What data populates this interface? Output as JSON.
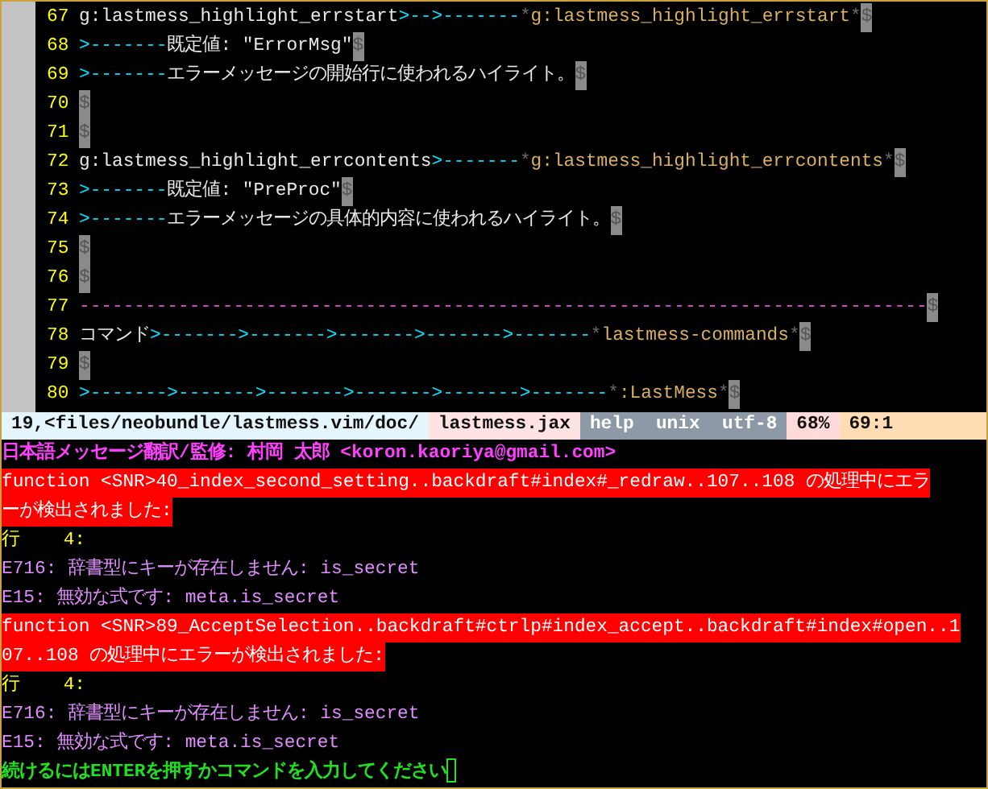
{
  "buffer": {
    "lines": [
      {
        "number": "67",
        "segments": [
          {
            "kind": "text",
            "text": "g:lastmess_highlight_errstart"
          },
          {
            "kind": "tab",
            "text": ">-->-------"
          },
          {
            "kind": "star",
            "text": "*"
          },
          {
            "kind": "tag",
            "text": "g:lastmess_highlight_errstart"
          },
          {
            "kind": "star",
            "text": "*"
          },
          {
            "kind": "eol",
            "text": "$"
          }
        ]
      },
      {
        "number": "68",
        "segments": [
          {
            "kind": "tab",
            "text": ">-------"
          },
          {
            "kind": "text",
            "text": "既定値: \"ErrorMsg\""
          },
          {
            "kind": "eol",
            "text": "$"
          }
        ]
      },
      {
        "number": "69",
        "segments": [
          {
            "kind": "tab",
            "text": ">-------"
          },
          {
            "kind": "text",
            "text": "エラーメッセージの開始行に使われるハイライト。"
          },
          {
            "kind": "eol",
            "text": "$"
          }
        ]
      },
      {
        "number": "70",
        "segments": [
          {
            "kind": "eol",
            "text": "$"
          }
        ]
      },
      {
        "number": "71",
        "segments": [
          {
            "kind": "eol",
            "text": "$"
          }
        ]
      },
      {
        "number": "72",
        "segments": [
          {
            "kind": "text",
            "text": "g:lastmess_highlight_errcontents"
          },
          {
            "kind": "tab",
            "text": ">-------"
          },
          {
            "kind": "star",
            "text": "*"
          },
          {
            "kind": "tag",
            "text": "g:lastmess_highlight_errcontents"
          },
          {
            "kind": "star",
            "text": "*"
          },
          {
            "kind": "eol",
            "text": "$"
          }
        ]
      },
      {
        "number": "73",
        "segments": [
          {
            "kind": "tab",
            "text": ">-------"
          },
          {
            "kind": "text",
            "text": "既定値: \"PreProc\""
          },
          {
            "kind": "eol",
            "text": "$"
          }
        ]
      },
      {
        "number": "74",
        "segments": [
          {
            "kind": "tab",
            "text": ">-------"
          },
          {
            "kind": "text",
            "text": "エラーメッセージの具体的内容に使われるハイライト。"
          },
          {
            "kind": "eol",
            "text": "$"
          }
        ]
      },
      {
        "number": "75",
        "segments": [
          {
            "kind": "eol",
            "text": "$"
          }
        ]
      },
      {
        "number": "76",
        "segments": [
          {
            "kind": "eol",
            "text": "$"
          }
        ]
      },
      {
        "number": "77",
        "segments": [
          {
            "kind": "rule",
            "text": "-----------------------------------------------------------------------------"
          },
          {
            "kind": "eol",
            "text": "$"
          }
        ]
      },
      {
        "number": "78",
        "segments": [
          {
            "kind": "text",
            "text": "コマンド"
          },
          {
            "kind": "tab",
            "text": ">------->------->------->------->-------"
          },
          {
            "kind": "star",
            "text": "*"
          },
          {
            "kind": "tag",
            "text": "lastmess-commands"
          },
          {
            "kind": "star",
            "text": "*"
          },
          {
            "kind": "eol",
            "text": "$"
          }
        ]
      },
      {
        "number": "79",
        "segments": [
          {
            "kind": "eol",
            "text": "$"
          }
        ]
      },
      {
        "number": "80",
        "segments": [
          {
            "kind": "tab",
            "text": ">------->------->------->------->------->-------"
          },
          {
            "kind": "star",
            "text": "*"
          },
          {
            "kind": "tag",
            "text": ":LastMess"
          },
          {
            "kind": "star",
            "text": "*"
          },
          {
            "kind": "eol",
            "text": "$"
          }
        ]
      }
    ]
  },
  "status_line": [
    {
      "text": "19,<files/neobundle/lastmess.vim/doc/",
      "color": "#e4f6fc"
    },
    {
      "text": "lastmess.jax",
      "color": "#ffe2e2"
    },
    {
      "text": "help  unix  utf-8",
      "color": "#8e99a8"
    },
    {
      "text": "68%",
      "color": "#ffdada"
    },
    {
      "text": "69:1",
      "color": "#ffdcb4"
    }
  ],
  "messages": [
    {
      "kind": "title",
      "text": "日本語メッセージ翻訳/監修: 村岡 太郎 <koron.kaoriya@gmail.com>"
    },
    {
      "kind": "error",
      "text": "function <SNR>40_index_second_setting..backdraft#index#_redraw..107..108 の処理中にエラ"
    },
    {
      "kind": "error",
      "text": "ーが検出されました:"
    },
    {
      "kind": "lnum",
      "text": "行    4:"
    },
    {
      "kind": "detail",
      "text": "E716: 辞書型にキーが存在しません: is_secret"
    },
    {
      "kind": "detail",
      "text": "E15: 無効な式です: meta.is_secret"
    },
    {
      "kind": "error",
      "text": "function <SNR>89_AcceptSelection..backdraft#ctrlp#index_accept..backdraft#index#open..1"
    },
    {
      "kind": "error",
      "text": "07..108 の処理中にエラーが検出されました:"
    },
    {
      "kind": "lnum",
      "text": "行    4:"
    },
    {
      "kind": "detail",
      "text": "E716: 辞書型にキーが存在しません: is_secret"
    },
    {
      "kind": "detail",
      "text": "E15: 無効な式です: meta.is_secret"
    },
    {
      "kind": "prompt",
      "text": "続けるにはENTERを押すかコマンドを入力してください"
    }
  ]
}
